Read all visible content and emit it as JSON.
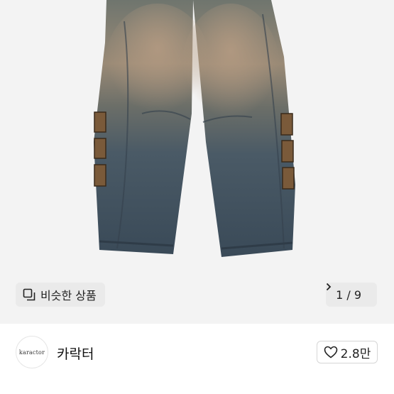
{
  "product_image": {
    "alt": ""
  },
  "similar_button": {
    "label": "비슷한 상품",
    "icon": "similar-items-icon"
  },
  "pager": {
    "label": "1 / 9",
    "icon": "chevron-right-icon"
  },
  "seller": {
    "avatar_text": "karactor",
    "name": "카락터"
  },
  "like_button": {
    "count": "2.8만",
    "icon": "heart-outline-icon"
  },
  "colors": {
    "hero_bg": "#f3f3f3",
    "chip_bg": "#eaeaea",
    "denim": "#3f5160",
    "faded": "#8b8b7a"
  }
}
